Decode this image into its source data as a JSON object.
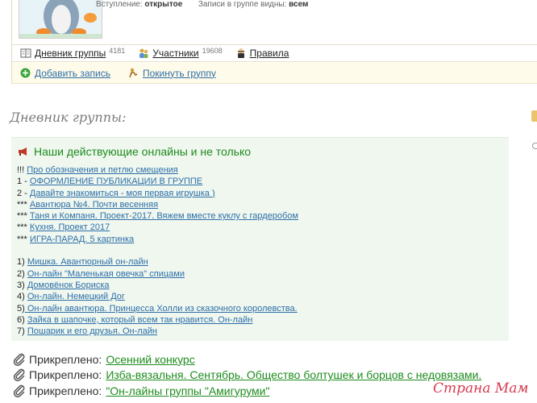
{
  "header": {
    "entry_label": "Вступление:",
    "entry_value": "открытое",
    "posts_visible_label": "Записи в группе видны:",
    "posts_visible_value": "всем"
  },
  "tabs": [
    {
      "label": "Дневник группы",
      "count": "4181",
      "icon": "book-icon"
    },
    {
      "label": "Участники",
      "count": "19608",
      "icon": "people-icon"
    },
    {
      "label": "Правила",
      "count": "",
      "icon": "judge-icon"
    }
  ],
  "actions": [
    {
      "label": "Добавить запись",
      "icon": "add-icon"
    },
    {
      "label": "Покинуть группу",
      "icon": "leave-icon"
    }
  ],
  "diary": {
    "title": "Дневник группы:"
  },
  "pinned_box": {
    "heading": "Наши действующие онлайны и не только",
    "heading_icon": "megaphone-icon",
    "lines": [
      {
        "prefix": "!!! ",
        "link": "Про обозначения и петлю смещения"
      },
      {
        "prefix": "1 - ",
        "link": "ОФОРМЛЕНИЕ ПУБЛИКАЦИИ В ГРУППЕ"
      },
      {
        "prefix": "2 - ",
        "link": "Давайте знакомиться - моя первая игрушка )"
      },
      {
        "prefix": "*** ",
        "link": "Авантюра №4. Почти весенняя"
      },
      {
        "prefix": "*** ",
        "link": "Таня и Компаня. Проект-2017. Вяжем вместе куклу с гардеробом"
      },
      {
        "prefix": "*** ",
        "link": "Кухня. Проект 2017"
      },
      {
        "prefix": "*** ",
        "link": "ИГРА-ПАРАД. 5 картинка"
      }
    ],
    "numbered": [
      {
        "prefix": "1) ",
        "link": "Мишка. Авантюрный он-лайн"
      },
      {
        "prefix": "2) ",
        "link": "Он-лайн \"Маленькая овечка\" спицами"
      },
      {
        "prefix": "3) ",
        "link": "Домовёнок Бориска"
      },
      {
        "prefix": "4) ",
        "link": "Он-лайн. Немецкий Дог"
      },
      {
        "prefix": "5)",
        "link": " Он-лайн авантюра. Принцесса Холли из сказочного королевства."
      },
      {
        "prefix": "6) ",
        "link": "Зайка в шапочке, который всем так нравится. Он-лайн"
      },
      {
        "prefix": "7) ",
        "link": "Пошарик и его друзья. Он-лайн"
      }
    ]
  },
  "attached": [
    {
      "prefix": "Прикреплено:",
      "link": "Осенний конкурс"
    },
    {
      "prefix": "Прикреплено:",
      "link": "Изба-вязальня. Сентябрь. Общество болтушек и борцов с недовязами."
    },
    {
      "prefix": "Прикреплено:",
      "link": "\"Он-лайны группы \"Амигуруми\""
    }
  ],
  "watermark": "Страна Мам"
}
